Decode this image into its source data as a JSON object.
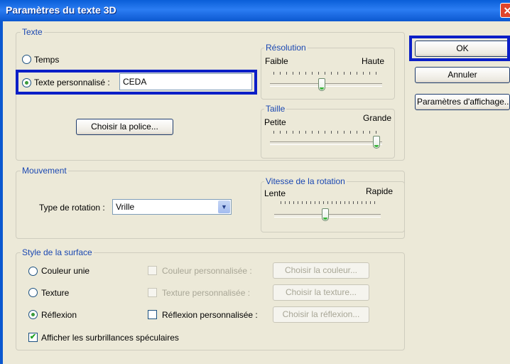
{
  "window": {
    "title": "Paramètres du texte 3D",
    "close_glyph": "✕"
  },
  "text_group": {
    "legend": "Texte",
    "option_time": "Temps",
    "option_custom": "Texte personnalisé :",
    "custom_text_value": "CEDA",
    "choose_font_button": "Choisir la police..."
  },
  "resolution": {
    "legend": "Résolution",
    "min_label": "Faible",
    "max_label": "Haute",
    "level": 0.4
  },
  "size": {
    "legend": "Taille",
    "min_label": "Petite",
    "max_label": "Grande",
    "level": 1.0
  },
  "motion_group": {
    "legend": "Mouvement",
    "rotation_type_label": "Type de rotation :",
    "rotation_type_value": "Vrille"
  },
  "rotation_speed": {
    "legend": "Vitesse de la rotation",
    "min_label": "Lente",
    "max_label": "Rapide",
    "level": 0.45
  },
  "surface_group": {
    "legend": "Style de la surface",
    "option_solid": "Couleur unie",
    "option_texture": "Texture",
    "option_reflection": "Réflexion",
    "custom_color_check": "Couleur personnalisée :",
    "custom_texture_check": "Texture personnalisée :",
    "custom_reflection_check": "Réflexion personnalisée :",
    "choose_color_button": "Choisir la couleur...",
    "choose_texture_button": "Choisir la texture...",
    "choose_reflection_button": "Choisir la réflexion...",
    "specular_check": "Afficher les surbrillances spéculaires"
  },
  "buttons": {
    "ok": "OK",
    "cancel": "Annuler",
    "display_settings": "Paramètres d'affichage..."
  },
  "colors": {
    "titlebar": "#0b58d0",
    "highlight": "#0b1fc7",
    "legend_text": "#1b48b2",
    "dialog_bg": "#ece9d8"
  }
}
